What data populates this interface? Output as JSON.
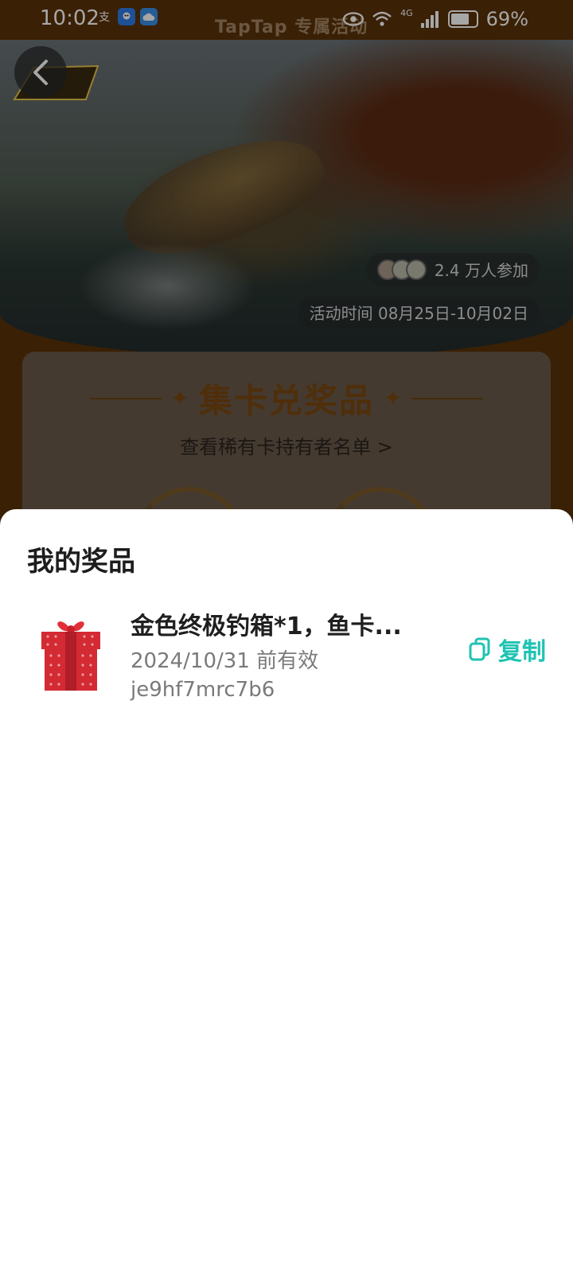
{
  "status_bar": {
    "time": "10:02",
    "app_icons": [
      "alipay-icon",
      "qq-icon",
      "cloud-icon"
    ],
    "brand_text": "TapTap 专属活动",
    "network": "4G",
    "battery": "69%"
  },
  "background": {
    "participants": "2.4 万人参加",
    "event_time": "活动时间 08月25日-10月02日",
    "card_section_title": "集卡兑奖品",
    "card_section_link": "查看稀有卡持有者名单 >"
  },
  "sheet": {
    "title": "我的奖品",
    "prizes": [
      {
        "name": "金色终极钓箱*1，鱼卡...",
        "expiry": "2024/10/31 前有效",
        "code": "je9hf7mrc7b6",
        "copy_label": "复制"
      }
    ]
  },
  "colors": {
    "accent": "#1fc3b3",
    "sheet_background": "#ffffff",
    "page_background": "#5a3208",
    "gift_red": "#d42a34"
  }
}
